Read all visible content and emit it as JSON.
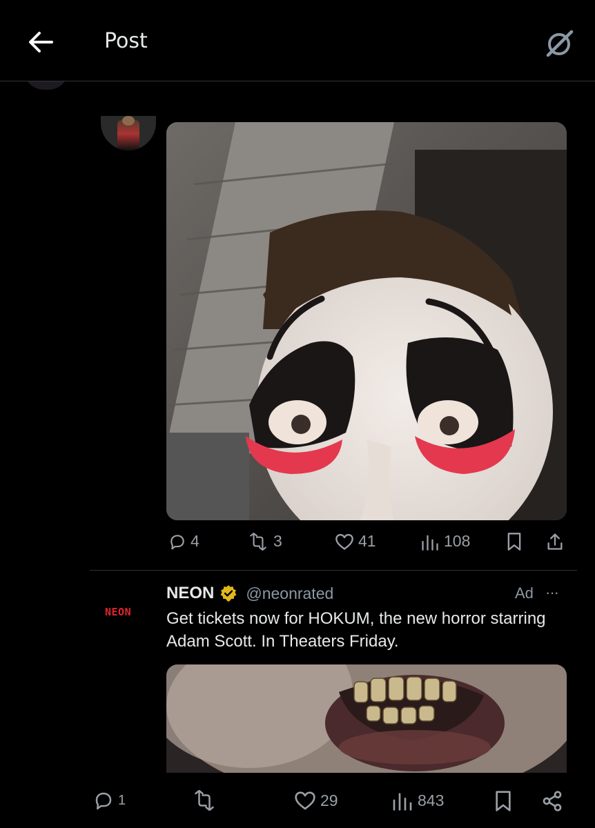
{
  "header": {
    "title": "Post",
    "back_icon": "arrow-left-icon",
    "grok_icon": "grok-slash-icon"
  },
  "reply_post": {
    "actions": {
      "replies": "4",
      "reposts": "3",
      "likes": "41",
      "views": "108"
    }
  },
  "ad": {
    "logo_text": "NEON",
    "name": "NEON",
    "handle": "@neonrated",
    "ad_label": "Ad",
    "more": "···",
    "text": "Get tickets now for HOKUM, the new horror starring Adam Scott. In Theaters Friday.",
    "actions": {
      "replies": "1",
      "reposts": "",
      "likes": "29",
      "views": "843"
    }
  },
  "colors": {
    "background": "#000000",
    "text": "#e7e9ea",
    "muted": "#71767b",
    "verified_gold": "#e2b719",
    "neon_red": "#e0242c"
  }
}
